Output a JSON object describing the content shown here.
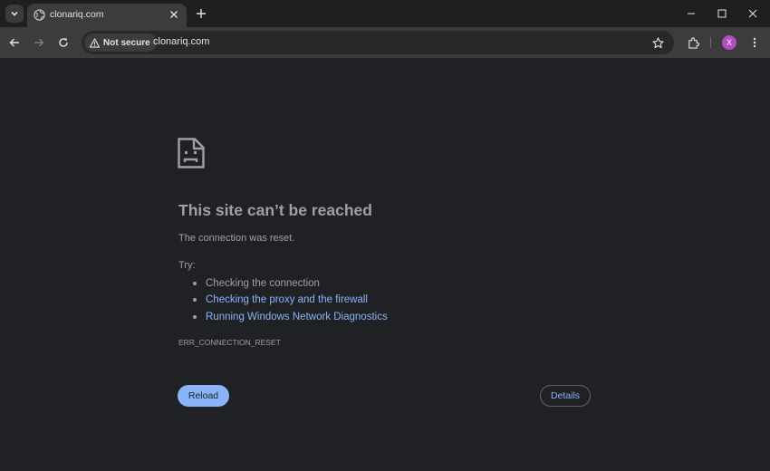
{
  "tab": {
    "title": "clonariq.com"
  },
  "toolbar": {
    "security_label": "Not secure",
    "url": "clonariq.com",
    "profile_initial": "X"
  },
  "error_page": {
    "title": "This site can’t be reached",
    "description": "The connection was reset.",
    "try_label": "Try:",
    "suggestions": [
      {
        "text": "Checking the connection",
        "is_link": false
      },
      {
        "text": "Checking the proxy and the firewall",
        "is_link": true
      },
      {
        "text": "Running Windows Network Diagnostics",
        "is_link": true
      }
    ],
    "error_code": "ERR_CONNECTION_RESET",
    "reload_label": "Reload",
    "details_label": "Details"
  },
  "colors": {
    "page_background": "#202124",
    "link": "#8ab4f8",
    "avatar": "#b04fc4"
  },
  "icons": [
    "chevron-down-icon",
    "globe-icon",
    "close-icon",
    "plus-icon",
    "minimize-icon",
    "maximize-icon",
    "back-arrow-icon",
    "forward-arrow-icon",
    "reload-icon",
    "warning-icon",
    "star-icon",
    "extensions-icon",
    "kebab-menu-icon",
    "sad-document-icon"
  ]
}
